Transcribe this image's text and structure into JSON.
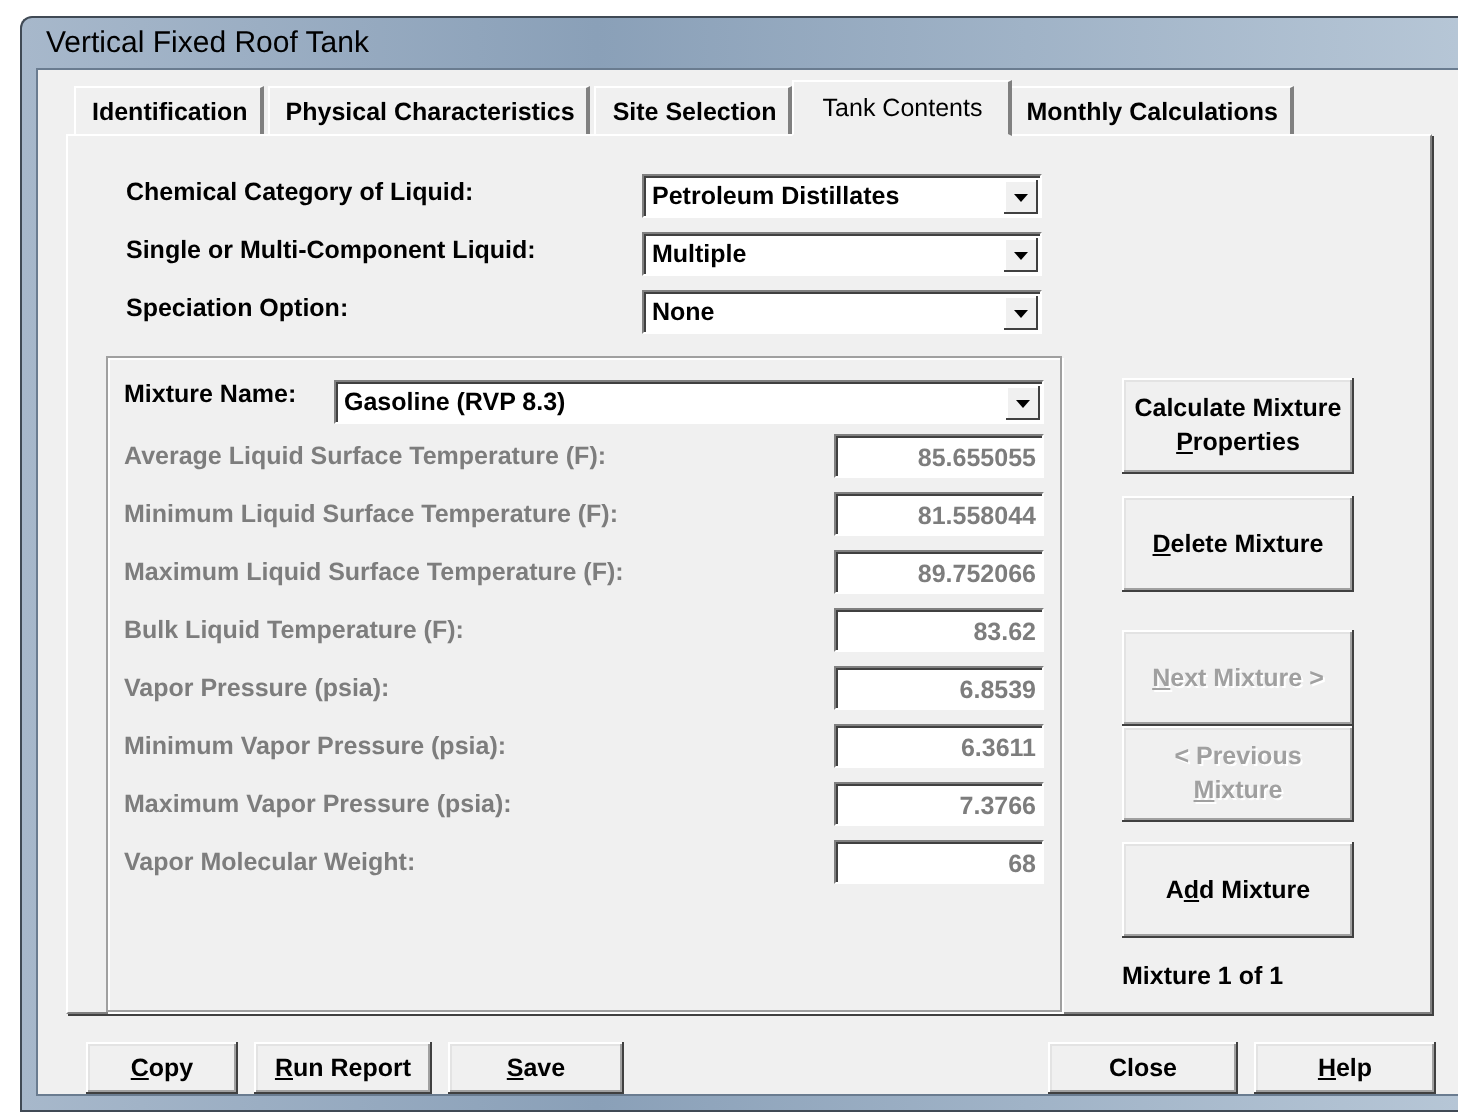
{
  "window": {
    "title": "Vertical Fixed Roof Tank"
  },
  "tabs": [
    {
      "label": "Identification",
      "selected": false
    },
    {
      "label": "Physical Characteristics",
      "selected": false
    },
    {
      "label": "Site Selection",
      "selected": false
    },
    {
      "label": "Tank Contents",
      "selected": true
    },
    {
      "label": "Monthly Calculations",
      "selected": false
    }
  ],
  "liquid_settings": [
    {
      "label": "Chemical Category of Liquid:",
      "value": "Petroleum Distillates"
    },
    {
      "label": "Single or Multi-Component Liquid:",
      "value": "Multiple"
    },
    {
      "label": "Speciation Option:",
      "value": "None"
    }
  ],
  "mixture": {
    "label": "Mixture Name:",
    "value": "Gasoline (RVP 8.3)"
  },
  "properties": [
    {
      "label": "Average Liquid Surface Temperature (F):",
      "value": "85.655055",
      "disabled": true
    },
    {
      "label": "Minimum Liquid Surface Temperature (F):",
      "value": "81.558044",
      "disabled": true
    },
    {
      "label": "Maximum Liquid Surface Temperature (F):",
      "value": "89.752066",
      "disabled": true
    },
    {
      "label": "Bulk Liquid Temperature (F):",
      "value": "83.62",
      "disabled": true
    },
    {
      "label": "Vapor Pressure (psia):",
      "value": "6.8539",
      "disabled": true
    },
    {
      "label": "Minimum Vapor Pressure (psia):",
      "value": "6.3611",
      "disabled": true
    },
    {
      "label": "Maximum Vapor Pressure (psia):",
      "value": "7.3766",
      "disabled": true
    },
    {
      "label": "Vapor Molecular Weight:",
      "value": "68",
      "disabled": true
    }
  ],
  "mixture_buttons": [
    {
      "label": [
        {
          "text": "Calculate Mixture ",
          "underline": false
        },
        {
          "text": "P",
          "underline": true
        },
        {
          "text": "roperties",
          "underline": false
        }
      ],
      "disabled": false
    },
    {
      "label": [
        {
          "text": "D",
          "underline": true
        },
        {
          "text": "elete Mixture",
          "underline": false
        }
      ],
      "disabled": false
    },
    {
      "label": [
        {
          "text": "N",
          "underline": true
        },
        {
          "text": "ext Mixture >",
          "underline": false
        }
      ],
      "disabled": true
    },
    {
      "label": [
        {
          "text": "< Previous ",
          "underline": false
        },
        {
          "text": "M",
          "underline": true
        },
        {
          "text": "ixture",
          "underline": false
        }
      ],
      "disabled": true
    },
    {
      "label": [
        {
          "text": "A",
          "underline": false
        },
        {
          "text": "d",
          "underline": true
        },
        {
          "text": "d Mixture",
          "underline": false
        }
      ],
      "disabled": false
    }
  ],
  "mixture_counter": "Mixture 1 of 1",
  "footer_buttons": {
    "left": [
      {
        "label": [
          {
            "text": "C",
            "underline": true
          },
          {
            "text": "opy",
            "underline": false
          }
        ]
      },
      {
        "label": [
          {
            "text": "R",
            "underline": true
          },
          {
            "text": "un Report",
            "underline": false
          }
        ]
      },
      {
        "label": [
          {
            "text": "S",
            "underline": true
          },
          {
            "text": "ave",
            "underline": false
          }
        ]
      }
    ],
    "right": [
      {
        "label": [
          {
            "text": "Close",
            "underline": false
          }
        ]
      },
      {
        "label": [
          {
            "text": "H",
            "underline": true
          },
          {
            "text": "elp",
            "underline": false
          }
        ]
      }
    ]
  }
}
